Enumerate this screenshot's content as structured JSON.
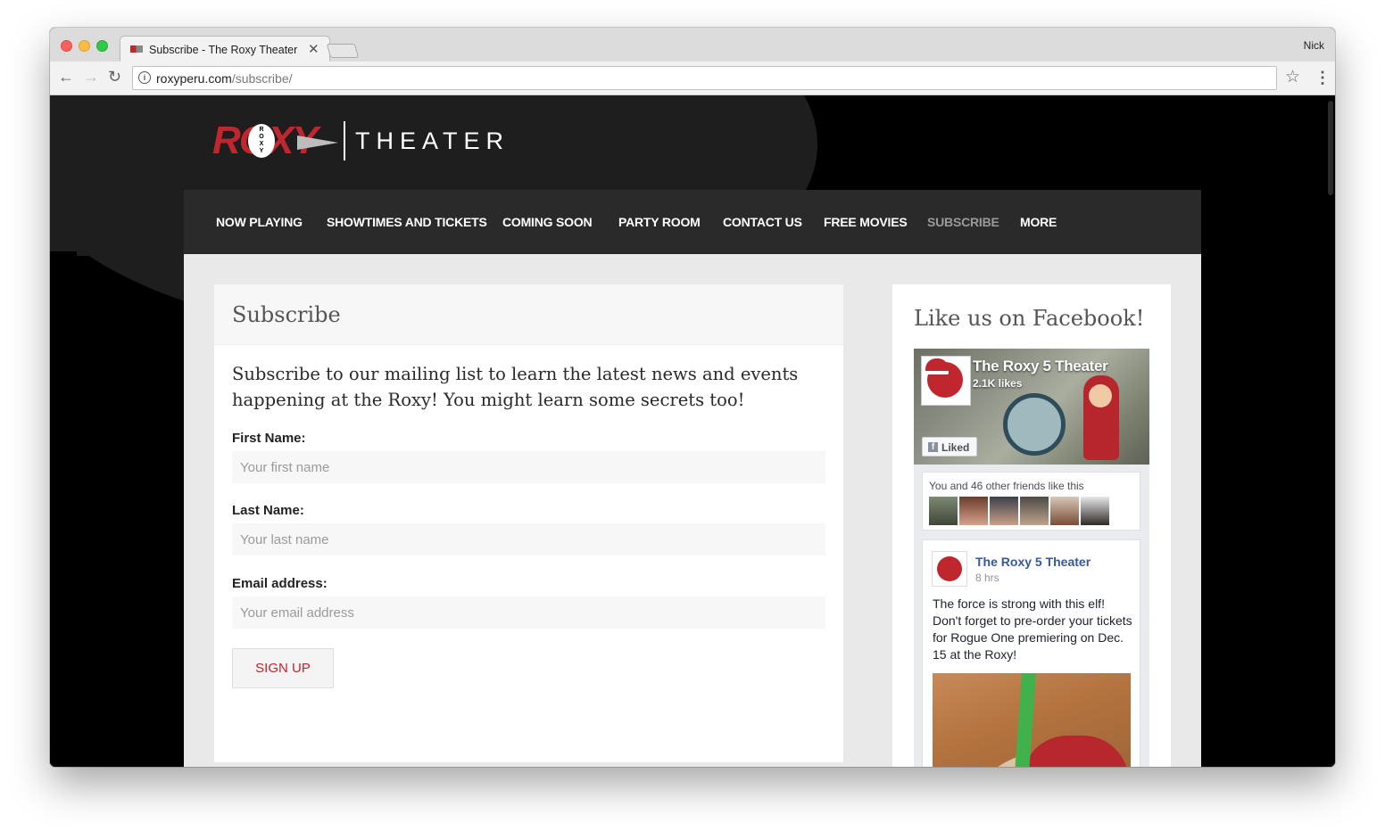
{
  "browser": {
    "tab_title": "Subscribe - The Roxy Theater",
    "tab_close": "✕",
    "profile_name": "Nick",
    "url_host": "roxyperu.com",
    "url_path": "/subscribe/",
    "icons": [
      "back-arrow-icon",
      "forward-arrow-icon",
      "reload-icon",
      "info-icon",
      "star-icon",
      "menu-icon"
    ]
  },
  "logo": {
    "roxy": "ROXY",
    "roxy_small": "R O X Y",
    "theater": "THEATER"
  },
  "nav": {
    "items": [
      {
        "label": "NOW PLAYING"
      },
      {
        "label": "SHOWTIMES AND TICKETS"
      },
      {
        "label": "COMING SOON"
      },
      {
        "label": "PARTY ROOM"
      },
      {
        "label": "CONTACT US"
      },
      {
        "label": "FREE MOVIES"
      },
      {
        "label": "SUBSCRIBE"
      },
      {
        "label": "MORE"
      }
    ],
    "active": "SUBSCRIBE"
  },
  "subscribe": {
    "title": "Subscribe",
    "intro": "Subscribe to our mailing list to learn the latest news and events happening at the Roxy! You might learn some secrets too!",
    "first_name_label": "First Name:",
    "first_name_placeholder": "Your first name",
    "last_name_label": "Last Name:",
    "last_name_placeholder": "Your last name",
    "email_label": "Email address:",
    "email_placeholder": "Your email address",
    "button_label": "SIGN UP"
  },
  "sidebar": {
    "title": "Like us on Facebook!",
    "fb": {
      "page_name": "The Roxy 5 Theater",
      "likes": "2.1K likes",
      "liked_label": "Liked",
      "friends_text": "You and 46 other friends like this",
      "post_name": "The Roxy 5 Theater",
      "post_time": "8 hrs",
      "post_text": "The force is strong with this elf! Don't forget to pre-order your tickets for Rogue One premiering on Dec. 15 at the Roxy!"
    }
  },
  "colors": {
    "brand_red": "#c0262d",
    "nav_bg": "#2a2a2a",
    "fb_blue": "#365899"
  }
}
